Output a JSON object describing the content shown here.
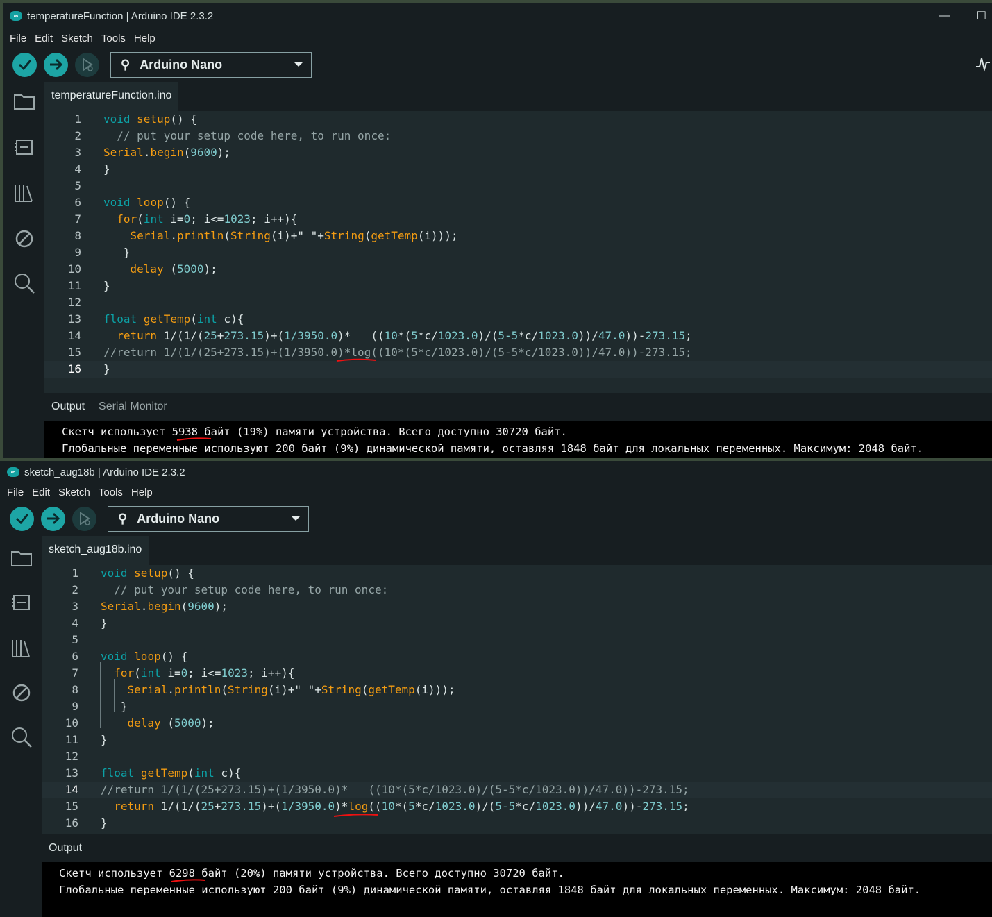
{
  "windows": [
    {
      "title": "temperatureFunction | Arduino IDE 2.3.2",
      "menu": [
        "File",
        "Edit",
        "Sketch",
        "Tools",
        "Help"
      ],
      "board": "Arduino Nano",
      "tab": "temperatureFunction.ino",
      "output_tabs": [
        "Output",
        "Serial Monitor"
      ],
      "output": [
        "Скетч использует 5938 байт (19%) памяти устройства. Всего доступно 30720 байт.",
        "Глобальные переменные используют 200 байт (9%) динамической памяти, оставляя 1848 байт для локальных переменных. Максимум: 2048 байт."
      ]
    },
    {
      "title": "sketch_aug18b | Arduino IDE 2.3.2",
      "menu": [
        "File",
        "Edit",
        "Sketch",
        "Tools",
        "Help"
      ],
      "board": "Arduino Nano",
      "tab": "sketch_aug18b.ino",
      "output_tabs": [
        "Output"
      ],
      "output": [
        "Скетч использует 6298 байт (20%) памяти устройства. Всего доступно 30720 байт.",
        "Глобальные переменные используют 200 байт (9%) динамической памяти, оставляя 1848 байт для локальных переменных. Максимум: 2048 байт."
      ]
    }
  ],
  "code1": {
    "l1": {
      "n": "1",
      "a": "void",
      "b": " ",
      "c": "setup",
      "d": "() {"
    },
    "l2": {
      "n": "2",
      "t": "  // put your setup code here, to run once:"
    },
    "l3": {
      "n": "3",
      "a": "Serial",
      "b": ".",
      "c": "begin",
      "d": "(",
      "e": "9600",
      "f": ");"
    },
    "l4": {
      "n": "4",
      "t": "}"
    },
    "l5": {
      "n": "5"
    },
    "l6": {
      "n": "6",
      "a": "void",
      "b": " ",
      "c": "loop",
      "d": "() {"
    },
    "l7": {
      "n": "7",
      "a": "  for",
      "b": "(",
      "c": "int",
      "d": " i=",
      "e": "0",
      "f": "; i<=",
      "g": "1023",
      "h": "; i++){"
    },
    "l8": {
      "n": "8",
      "a": "    Serial",
      "b": ".",
      "c": "println",
      "d": "(",
      "e": "String",
      "f": "(i)+\" \"+",
      "g": "String",
      "h": "(",
      "i": "getTemp",
      "j": "(i)));"
    },
    "l9": {
      "n": "9",
      "t": "   }"
    },
    "l10": {
      "n": "10",
      "a": "    delay",
      "b": " (",
      "c": "5000",
      "d": ");"
    },
    "l11": {
      "n": "11",
      "t": "}"
    },
    "l12": {
      "n": "12"
    },
    "l13": {
      "n": "13",
      "a": "float",
      "b": " ",
      "c": "getTemp",
      "d": "(",
      "e": "int",
      "f": " c){"
    },
    "l14": {
      "n": "14",
      "a": "  return",
      "b": " 1/(1/(",
      "c": "25",
      "d": "+",
      "e": "273.15",
      "f": ")+(",
      "g": "1/3950.0",
      "h": ")*   ((",
      "i": "10",
      "j": "*(",
      "k": "5",
      "l": "*c/",
      "m": "1023.0",
      "o": ")/(",
      "p": "5-5",
      "q": "*c/",
      "r": "1023.0",
      "s": "))/",
      "u": "47.0",
      "v": "))-",
      "w": "273.15",
      "x": ";"
    },
    "l15": {
      "n": "15",
      "t": "//return 1/(1/(25+273.15)+(1/3950.0)*log((10*(5*c/1023.0)/(5-5*c/1023.0))/47.0))-273.15;"
    },
    "l16": {
      "n": "16",
      "t": "}"
    }
  },
  "code2": {
    "l14": {
      "n": "14",
      "t": "//return 1/(1/(25+273.15)+(1/3950.0)*   ((10*(5*c/1023.0)/(5-5*c/1023.0))/47.0))-273.15;"
    },
    "l15": {
      "n": "15",
      "a": "  return",
      "b": " 1/(1/(",
      "c": "25",
      "d": "+",
      "e": "273.15",
      "f": ")+(",
      "g": "1/3950.0",
      "h": ")*",
      "i": "log",
      "j": "((",
      "k": "10",
      "l": "*(",
      "m": "5",
      "o": "*c/",
      "p": "1023.0",
      "q": ")/(",
      "r": "5-5",
      "s": "*c/",
      "u": "1023.0",
      "v": "))/",
      "w": "47.0",
      "x": "))-",
      "y": "273.15",
      "z": ";"
    },
    "l16": {
      "n": "16",
      "t": "}"
    }
  }
}
